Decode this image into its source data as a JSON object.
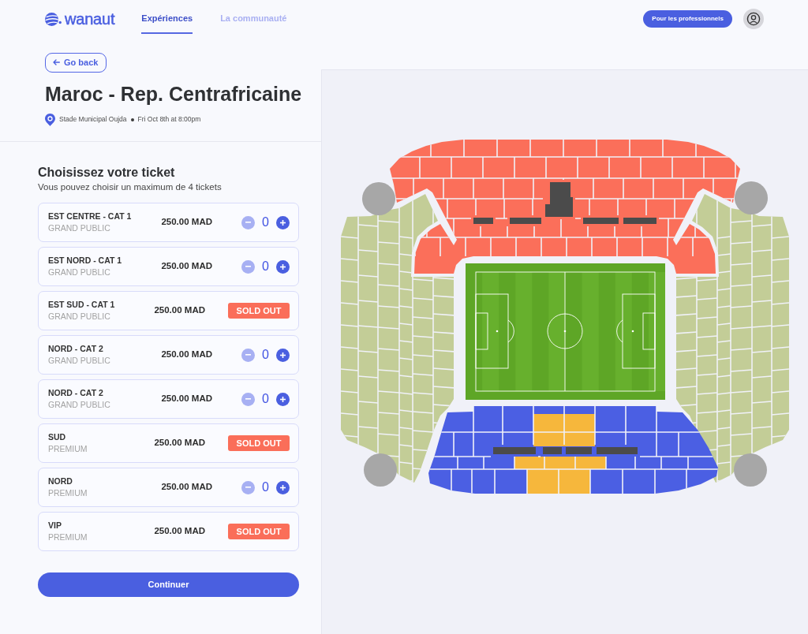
{
  "header": {
    "logo": "wanaut",
    "nav": [
      {
        "label": "Expériences",
        "selected": true
      },
      {
        "label": "La communauté",
        "selected": false
      }
    ],
    "pro_button": "Pour les professionnels"
  },
  "event": {
    "back_button": "Go back",
    "title": "Maroc - Rep. Centrafricaine",
    "venue": "Stade Municipal Oujda",
    "date": "Fri Oct 8th at 8:00pm"
  },
  "tickets": {
    "heading": "Choisissez votre ticket",
    "subheading": "Vous pouvez choisir un maximum de 4 tickets",
    "items": [
      {
        "name": "EST CENTRE - CAT 1",
        "category": "GRAND PUBLIC",
        "price": "250.00 MAD",
        "kind": "counter",
        "count": "0",
        "decrease_disabled": true
      },
      {
        "name": "EST NORD - CAT 1",
        "category": "GRAND PUBLIC",
        "price": "250.00 MAD",
        "kind": "counter",
        "count": "0",
        "decrease_disabled": true
      },
      {
        "name": "EST SUD - CAT 1",
        "category": "GRAND PUBLIC",
        "price": "250.00 MAD",
        "kind": "sold_out",
        "badge": "SOLD OUT"
      },
      {
        "name": "NORD - CAT 2",
        "category": "GRAND PUBLIC",
        "price": "250.00 MAD",
        "kind": "counter",
        "count": "0",
        "decrease_disabled": true
      },
      {
        "name": "NORD - CAT 2",
        "category": "GRAND PUBLIC",
        "price": "250.00 MAD",
        "kind": "counter",
        "count": "0",
        "decrease_disabled": true
      },
      {
        "name": "SUD",
        "category": "PREMIUM",
        "price": "250.00 MAD",
        "kind": "sold_out",
        "badge": "SOLD OUT"
      },
      {
        "name": "NORD",
        "category": "PREMIUM",
        "price": "250.00 MAD",
        "kind": "counter",
        "count": "0",
        "decrease_disabled": true
      },
      {
        "name": "VIP",
        "category": "PREMIUM",
        "price": "250.00 MAD",
        "kind": "sold_out",
        "badge": "SOLD OUT"
      }
    ]
  },
  "continue_button": "Continuer"
}
